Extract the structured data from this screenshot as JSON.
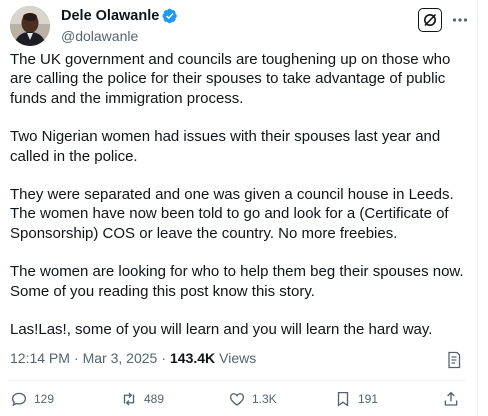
{
  "author": {
    "display_name": "Dele Olawanle",
    "handle": "@dolawanle",
    "verified_color": "#1d9bf0"
  },
  "header_actions": {
    "grok_icon": "grok-icon",
    "more_icon": "more-dots-icon"
  },
  "post": {
    "paragraphs": [
      "The UK government and councils are toughening up on those who are calling the police for their spouses to take advantage of public funds and the immigration process.",
      "Two Nigerian women had issues with their spouses last year and called in the police.",
      "They were separated and one was given a council house in Leeds. The women have now been told to go and look for a (Certificate of Sponsorship) COS or leave the country.  No more freebies.",
      "The women are looking for who to help them beg their spouses now. Some of you reading this post know this story.",
      "Las!Las!, some of you will learn and you will learn the hard way."
    ]
  },
  "meta": {
    "time": "12:14 PM",
    "separator": "·",
    "date": "Mar 3, 2025",
    "views_count": "143.4K",
    "views_label": "Views"
  },
  "actions": {
    "replies": "129",
    "reposts": "489",
    "likes": "1.3K",
    "bookmarks": "191"
  }
}
